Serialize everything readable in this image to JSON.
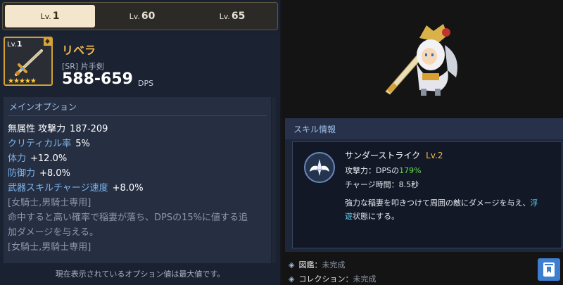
{
  "tabs": [
    {
      "pre": "Lv.",
      "num": "1"
    },
    {
      "pre": "Lv.",
      "num": "60"
    },
    {
      "pre": "Lv.",
      "num": "65"
    }
  ],
  "weapon": {
    "level_pre": "Lv.",
    "level": "1",
    "stars": "★★★★★",
    "name": "リベラ",
    "rarity": "[SR] 片手剣",
    "dps": "588-659",
    "dps_unit": "DPS"
  },
  "options": {
    "title": "メインオプション",
    "rows": [
      {
        "key": "無属性 攻撃力",
        "value": "187-209"
      },
      {
        "key": "クリティカル率",
        "value": "5%"
      },
      {
        "key": "体力",
        "value": "+12.0%"
      },
      {
        "key": "防御力",
        "value": "+8.0%"
      },
      {
        "key": "武器スキルチャージ速度",
        "value": "+8.0%"
      }
    ],
    "sub1": "[女騎士,男騎士専用]",
    "desc1": "命中すると高い確率で稲妻が落ち、DPSの15%に値する追",
    "desc2": "加ダメージを与える。",
    "sub2": "[女騎士,男騎士専用]"
  },
  "footer_note": "現在表示されているオプション値は最大値です。",
  "skill": {
    "section_title": "スキル情報",
    "name": "サンダーストライク",
    "level": "Lv.2",
    "attack_label": "攻撃力：DPSの",
    "attack_value": "179%",
    "charge": "チャージ時間：8.5秒",
    "desc_a": "強力な稲妻を叩きつけて周囲の敵にダメージを与え、",
    "desc_hl1": "浮",
    "desc_hl2": "遊",
    "desc_b": "状態にする。"
  },
  "collection": [
    {
      "label": "図鑑",
      "value": "未完成"
    },
    {
      "label": "コレクション",
      "value": "未完成"
    }
  ],
  "icons": {
    "thumb": "sword-icon",
    "skill": "winged-sword-emblem-icon",
    "book": "bookmark-book-icon",
    "diamond": "diamond-bullet-icon"
  }
}
